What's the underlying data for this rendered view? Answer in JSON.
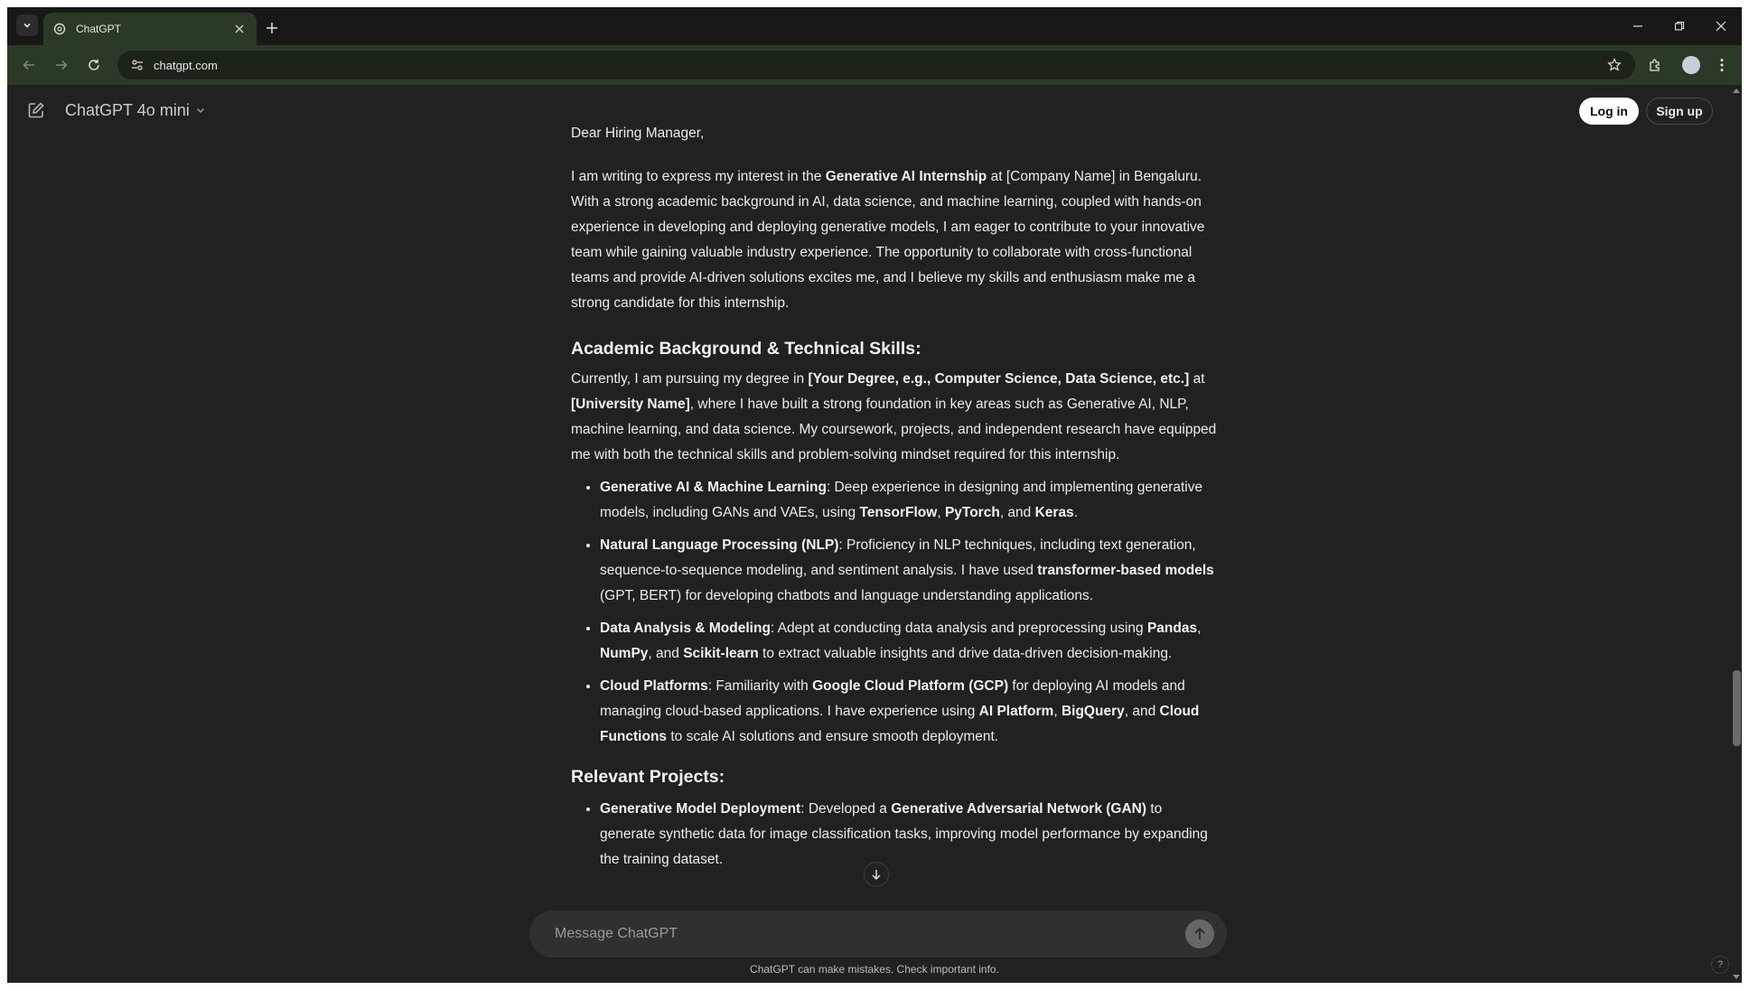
{
  "browser": {
    "tab_title": "ChatGPT",
    "url": "chatgpt.com"
  },
  "header": {
    "model_name": "ChatGPT 4o mini",
    "login_label": "Log in",
    "signup_label": "Sign up"
  },
  "message": {
    "greeting": "Dear Hiring Manager,",
    "intro": [
      {
        "t": "I am writing to express my interest in the "
      },
      {
        "t": "Generative AI Internship",
        "b": true
      },
      {
        "t": " at [Company Name] in Bengaluru. With a strong academic background in AI, data science, and machine learning, coupled with hands-on experience in developing and deploying generative models, I am eager to contribute to your innovative team while gaining valuable industry experience. The opportunity to collaborate with cross-functional teams and provide AI-driven solutions excites me, and I believe my skills and enthusiasm make me a strong candidate for this internship."
      }
    ],
    "section1_heading": "Academic Background & Technical Skills:",
    "section1_para": [
      {
        "t": "Currently, I am pursuing my degree in "
      },
      {
        "t": "[Your Degree, e.g., Computer Science, Data Science, etc.]",
        "b": true
      },
      {
        "t": " at "
      },
      {
        "t": "[University Name]",
        "b": true
      },
      {
        "t": ", where I have built a strong foundation in key areas such as Generative AI, NLP, machine learning, and data science. My coursework, projects, and independent research have equipped me with both the technical skills and problem-solving mindset required for this internship."
      }
    ],
    "skills": [
      [
        {
          "t": "Generative AI & Machine Learning",
          "b": true
        },
        {
          "t": ": Deep experience in designing and implementing generative models, including GANs and VAEs, using "
        },
        {
          "t": "TensorFlow",
          "b": true
        },
        {
          "t": ", "
        },
        {
          "t": "PyTorch",
          "b": true
        },
        {
          "t": ", and "
        },
        {
          "t": "Keras",
          "b": true
        },
        {
          "t": "."
        }
      ],
      [
        {
          "t": "Natural Language Processing (NLP)",
          "b": true
        },
        {
          "t": ": Proficiency in NLP techniques, including text generation, sequence-to-sequence modeling, and sentiment analysis. I have used "
        },
        {
          "t": "transformer-based models",
          "b": true
        },
        {
          "t": " (GPT, BERT) for developing chatbots and language understanding applications."
        }
      ],
      [
        {
          "t": "Data Analysis & Modeling",
          "b": true
        },
        {
          "t": ": Adept at conducting data analysis and preprocessing using "
        },
        {
          "t": "Pandas",
          "b": true
        },
        {
          "t": ", "
        },
        {
          "t": "NumPy",
          "b": true
        },
        {
          "t": ", and "
        },
        {
          "t": "Scikit-learn",
          "b": true
        },
        {
          "t": " to extract valuable insights and drive data-driven decision-making."
        }
      ],
      [
        {
          "t": "Cloud Platforms",
          "b": true
        },
        {
          "t": ": Familiarity with "
        },
        {
          "t": "Google Cloud Platform (GCP)",
          "b": true
        },
        {
          "t": " for deploying AI models and managing cloud-based applications. I have experience using "
        },
        {
          "t": "AI Platform",
          "b": true
        },
        {
          "t": ", "
        },
        {
          "t": "BigQuery",
          "b": true
        },
        {
          "t": ", and "
        },
        {
          "t": "Cloud Functions",
          "b": true
        },
        {
          "t": " to scale AI solutions and ensure smooth deployment."
        }
      ]
    ],
    "section2_heading": "Relevant Projects:",
    "projects": [
      [
        {
          "t": "Generative Model Deployment",
          "b": true
        },
        {
          "t": ": Developed a "
        },
        {
          "t": "Generative Adversarial Network (GAN)",
          "b": true
        },
        {
          "t": " to generate synthetic data for image classification tasks, improving model performance by expanding the training dataset."
        }
      ]
    ]
  },
  "composer": {
    "placeholder": "Message ChatGPT"
  },
  "footer": {
    "disclaimer": "ChatGPT can make mistakes. Check important info.",
    "help": "?"
  },
  "icons": {
    "tab_search": "chevron-down-icon",
    "favicon": "openai-logo-icon",
    "compose": "pencil-square-icon",
    "scroll_down": "arrow-down-icon",
    "send": "arrow-up-icon"
  }
}
